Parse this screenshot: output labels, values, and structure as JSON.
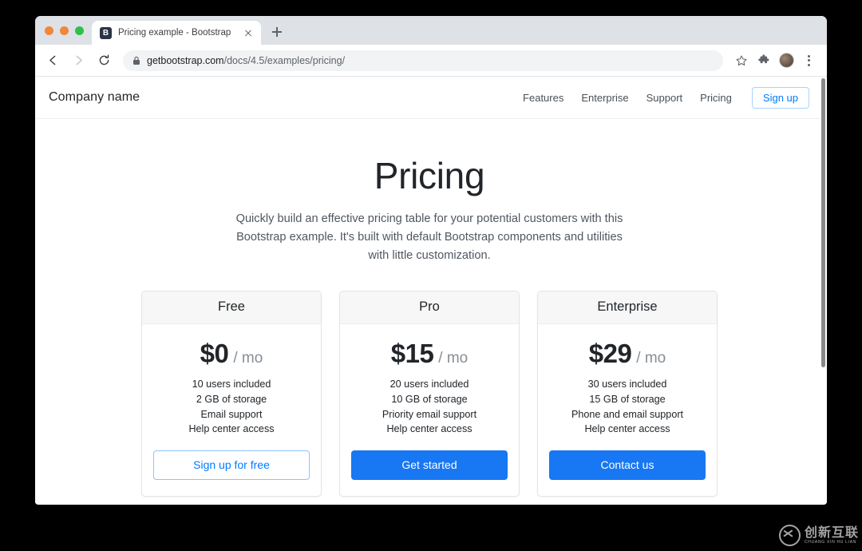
{
  "browser": {
    "traffic_lights": [
      "close",
      "minimize",
      "maximize"
    ],
    "tab": {
      "favicon_letter": "B",
      "title": "Pricing example - Bootstrap",
      "close_label": "×"
    },
    "new_tab_label": "+",
    "toolbar": {
      "back_label": "Back",
      "forward_label": "Forward",
      "reload_label": "Reload",
      "url_host": "getbootstrap.com",
      "url_path": "/docs/4.5/examples/pricing/",
      "bookmark_label": "Bookmark this tab",
      "extensions_label": "Extensions",
      "profile_label": "Profile",
      "menu_label": "Customize and control Google Chrome"
    }
  },
  "site": {
    "brand": "Company name",
    "nav_links": [
      {
        "label": "Features"
      },
      {
        "label": "Enterprise"
      },
      {
        "label": "Support"
      },
      {
        "label": "Pricing"
      }
    ],
    "signup_button": "Sign up"
  },
  "hero": {
    "title": "Pricing",
    "subtitle": "Quickly build an effective pricing table for your potential customers with this Bootstrap example. It's built with default Bootstrap components and utilities with little customization."
  },
  "pricing": {
    "cards": [
      {
        "name": "Free",
        "price": "$0",
        "period": "/ mo",
        "features": [
          "10 users included",
          "2 GB of storage",
          "Email support",
          "Help center access"
        ],
        "cta": "Sign up for free",
        "cta_style": "outline"
      },
      {
        "name": "Pro",
        "price": "$15",
        "period": "/ mo",
        "features": [
          "20 users included",
          "10 GB of storage",
          "Priority email support",
          "Help center access"
        ],
        "cta": "Get started",
        "cta_style": "solid"
      },
      {
        "name": "Enterprise",
        "price": "$29",
        "period": "/ mo",
        "features": [
          "30 users included",
          "15 GB of storage",
          "Phone and email support",
          "Help center access"
        ],
        "cta": "Contact us",
        "cta_style": "solid"
      }
    ]
  },
  "watermark": {
    "text_cn": "创新互联",
    "text_en": "CHUANG XIN HU LIAN"
  },
  "colors": {
    "accent_blue": "#007bff",
    "solid_button": "#1877f2",
    "page_bg": "#ffffff",
    "card_header_bg": "#f7f7f7",
    "desktop_bg": "#000000"
  }
}
